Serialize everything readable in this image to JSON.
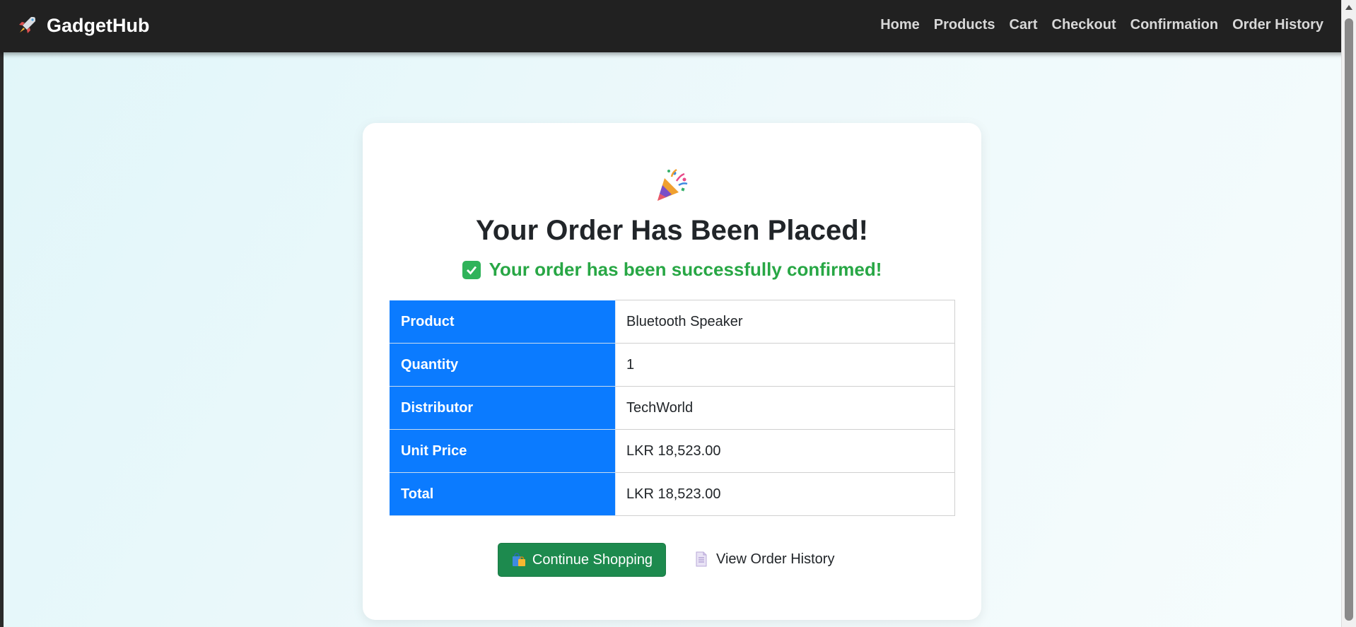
{
  "navbar": {
    "brand": "GadgetHub",
    "links": [
      "Home",
      "Products",
      "Cart",
      "Checkout",
      "Confirmation",
      "Order History"
    ]
  },
  "confirmation": {
    "title": "Your Order Has Been Placed!",
    "success_message": "Your order has been successfully confirmed!",
    "details": [
      {
        "label": "Product",
        "value": "Bluetooth Speaker"
      },
      {
        "label": "Quantity",
        "value": "1"
      },
      {
        "label": "Distributor",
        "value": "TechWorld"
      },
      {
        "label": "Unit Price",
        "value": "LKR 18,523.00"
      },
      {
        "label": "Total",
        "value": "LKR 18,523.00"
      }
    ],
    "continue_label": "Continue Shopping",
    "history_label": "View Order History"
  },
  "icons": {
    "brand": "rocket-icon",
    "heading": "party-popper-icon",
    "success": "check-mark-button-icon",
    "continue": "shopping-bags-icon",
    "history": "page-icon"
  },
  "colors": {
    "navbar_bg": "#212121",
    "primary_blue": "#0b7bff",
    "success_green": "#28a745",
    "button_green": "#1d8a4e"
  }
}
